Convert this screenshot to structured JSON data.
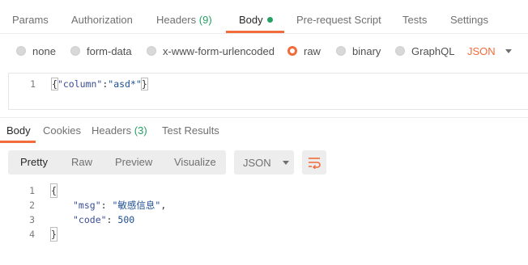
{
  "request_tabs": {
    "params": "Params",
    "authorization": "Authorization",
    "headers": "Headers",
    "headers_count": "(9)",
    "body": "Body",
    "pre_request": "Pre-request Script",
    "tests": "Tests",
    "settings": "Settings"
  },
  "body_types": {
    "none": "none",
    "form_data": "form-data",
    "urlencoded": "x-www-form-urlencoded",
    "raw": "raw",
    "binary": "binary",
    "graphql": "GraphQL",
    "selected": "raw",
    "language": "JSON"
  },
  "request_editor": {
    "line_number": "1",
    "open_brace": "{",
    "key": "\"column\"",
    "colon": ":",
    "value": "\"asd*\"",
    "close_brace": "}"
  },
  "response_tabs": {
    "body": "Body",
    "cookies": "Cookies",
    "headers": "Headers",
    "headers_count": "(3)",
    "test_results": "Test Results"
  },
  "view_modes": {
    "pretty": "Pretty",
    "raw": "Raw",
    "preview": "Preview",
    "visualize": "Visualize",
    "selected": "Pretty"
  },
  "response_format": "JSON",
  "response_editor": {
    "lines": [
      {
        "num": "1",
        "open": "{"
      },
      {
        "num": "2",
        "key": "\"msg\"",
        "colon": ": ",
        "value": "\"敏感信息\"",
        "comma": ","
      },
      {
        "num": "3",
        "key": "\"code\"",
        "colon": ": ",
        "value": "500"
      },
      {
        "num": "4",
        "close": "}"
      }
    ]
  },
  "colors": {
    "accent": "#f26b3a",
    "success": "#26a064",
    "toolbar_bg": "#ededed"
  }
}
